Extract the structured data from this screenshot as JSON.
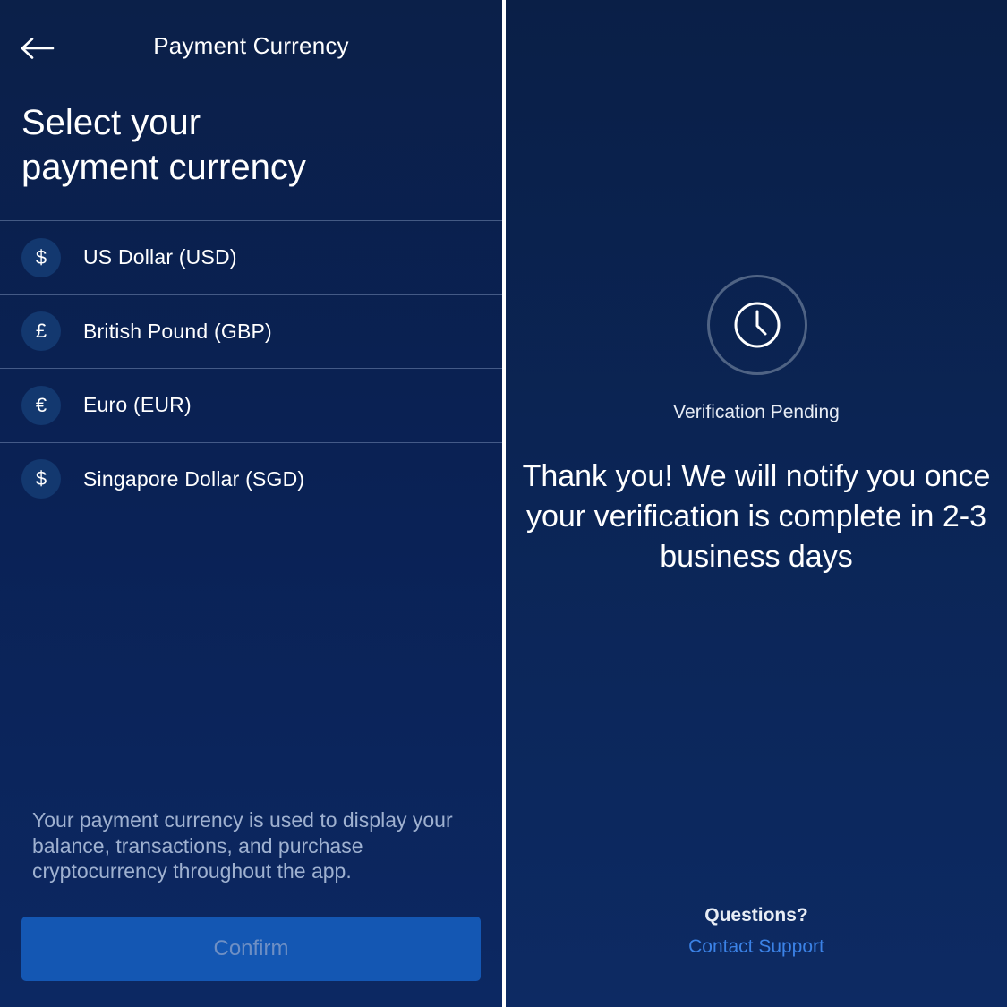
{
  "payment_screen": {
    "header": {
      "back_icon": "arrow-left-icon",
      "title": "Payment Currency"
    },
    "heading_lines": [
      "Select your",
      "payment currency"
    ],
    "currencies": [
      {
        "symbol": "$",
        "label": "US Dollar (USD)"
      },
      {
        "symbol": "£",
        "label": "British Pound (GBP)"
      },
      {
        "symbol": "€",
        "label": "Euro (EUR)"
      },
      {
        "symbol": "$",
        "label": "Singapore Dollar (SGD)"
      }
    ],
    "footnote": "Your payment currency is used to display your balance, transactions, and purchase cryptocurrency throughout the app.",
    "confirm_label": "Confirm"
  },
  "verification_screen": {
    "status_icon": "clock-icon",
    "status_label": "Verification Pending",
    "message": "Thank you! We will notify you once your verification is complete in 2-3 business days",
    "questions_label": "Questions?",
    "support_link": "Contact Support"
  },
  "colors": {
    "background": "#0b2350",
    "divider": "#8ca0c8",
    "symbol_circle": "#13386f",
    "confirm_button": "#1457b3",
    "confirm_text_disabled": "#6e8fc4",
    "link": "#3b82e6",
    "footnote_text": "#9fb1d0"
  }
}
